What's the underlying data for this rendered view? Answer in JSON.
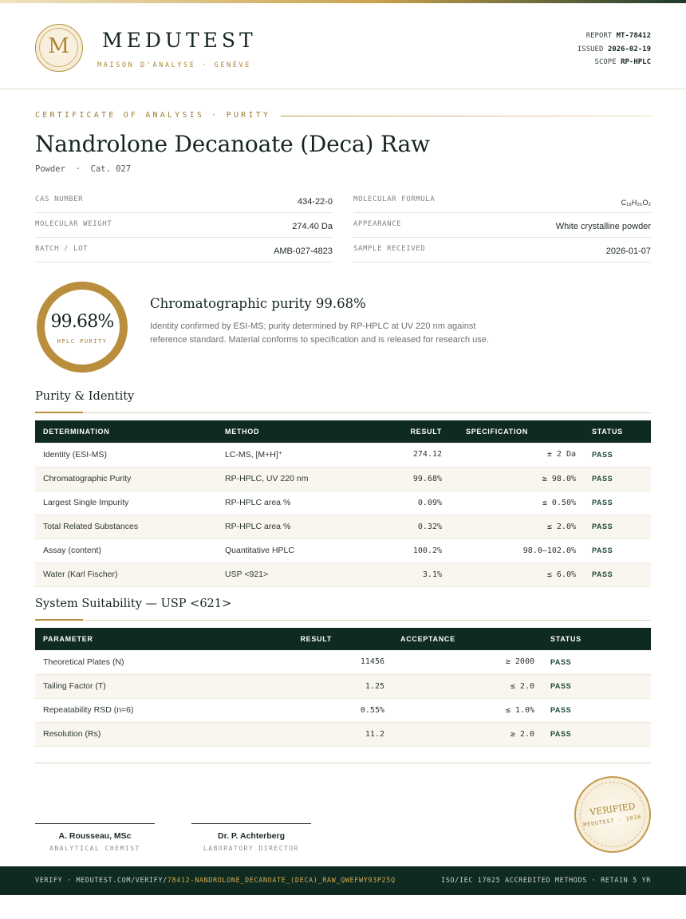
{
  "brand": {
    "monogram": "M",
    "name": "MEDUTEST",
    "tagline": "MAISON D'ANALYSE · GENÈVE"
  },
  "meta": {
    "report_label": "REPORT",
    "report_value": "MT-78412",
    "issued_label": "ISSUED",
    "issued_value": "2026-02-19",
    "scope_label": "SCOPE",
    "scope_value": "RP-HPLC"
  },
  "certificate": {
    "kicker": "CERTIFICATE OF ANALYSIS · PURITY",
    "title": "Nandrolone Decanoate (Deca) Raw",
    "subtitle": "Powder  ·  Cat. 027"
  },
  "info": {
    "left": [
      {
        "key": "CAS NUMBER",
        "value": "434-22-0"
      },
      {
        "key": "MOLECULAR WEIGHT",
        "value": "274.40 Da"
      },
      {
        "key": "BATCH / LOT",
        "value": "AMB-027-4823"
      }
    ],
    "right": [
      {
        "key": "MOLECULAR FORMULA",
        "value": "C₁₈H₂₆O₂"
      },
      {
        "key": "APPEARANCE",
        "value": "White crystalline powder"
      },
      {
        "key": "SAMPLE RECEIVED",
        "value": "2026-01-07"
      }
    ]
  },
  "purity": {
    "value": "99.68%",
    "label": "HPLC PURITY",
    "headline": "Chromatographic purity 99.68%",
    "description": "Identity confirmed by ESI-MS; purity determined by RP-HPLC at UV 220 nm against reference standard. Material conforms to specification and is released for research use."
  },
  "identity_section": {
    "title": "Purity & Identity",
    "headers": [
      "DETERMINATION",
      "METHOD",
      "RESULT",
      "SPECIFICATION",
      "STATUS"
    ],
    "rows": [
      [
        "Identity (ESI-MS)",
        "LC-MS, [M+H]⁺",
        "274.12",
        "± 2 Da",
        "PASS"
      ],
      [
        "Chromatographic Purity",
        "RP-HPLC, UV 220 nm",
        "99.68%",
        "≥ 98.0%",
        "PASS"
      ],
      [
        "Largest Single Impurity",
        "RP-HPLC area %",
        "0.09%",
        "≤ 0.50%",
        "PASS"
      ],
      [
        "Total Related Substances",
        "RP-HPLC area %",
        "0.32%",
        "≤ 2.0%",
        "PASS"
      ],
      [
        "Assay (content)",
        "Quantitative HPLC",
        "100.2%",
        "98.0–102.0%",
        "PASS"
      ],
      [
        "Water (Karl Fischer)",
        "USP <921>",
        "3.1%",
        "≤ 6.0%",
        "PASS"
      ]
    ]
  },
  "suitability_section": {
    "title": "System Suitability — USP <621>",
    "headers": [
      "PARAMETER",
      "RESULT",
      "ACCEPTANCE",
      "STATUS"
    ],
    "rows": [
      [
        "Theoretical Plates (N)",
        "11456",
        "≥ 2000",
        "PASS"
      ],
      [
        "Tailing Factor (T)",
        "1.25",
        "≤ 2.0",
        "PASS"
      ],
      [
        "Repeatability RSD (n=6)",
        "0.55%",
        "≤ 1.0%",
        "PASS"
      ],
      [
        "Resolution (Rs)",
        "11.2",
        "≥ 2.0",
        "PASS"
      ]
    ]
  },
  "signatures": [
    {
      "name": "A. Rousseau, MSc",
      "role": "ANALYTICAL CHEMIST"
    },
    {
      "name": "Dr. P. Achterberg",
      "role": "LABORATORY DIRECTOR"
    }
  ],
  "stamp": {
    "line1": "VERIFIED",
    "line2": "MEDUTEST · 2026"
  },
  "footer": {
    "verify_prefix": "VERIFY · MEDUTEST.COM/VERIFY/",
    "verify_code": "78412-NANDROLONE_DECANOATE_(DECA)_RAW_QWEFWY93P25Q",
    "right": "ISO/IEC 17025 ACCREDITED METHODS · RETAIN 5 YR"
  }
}
